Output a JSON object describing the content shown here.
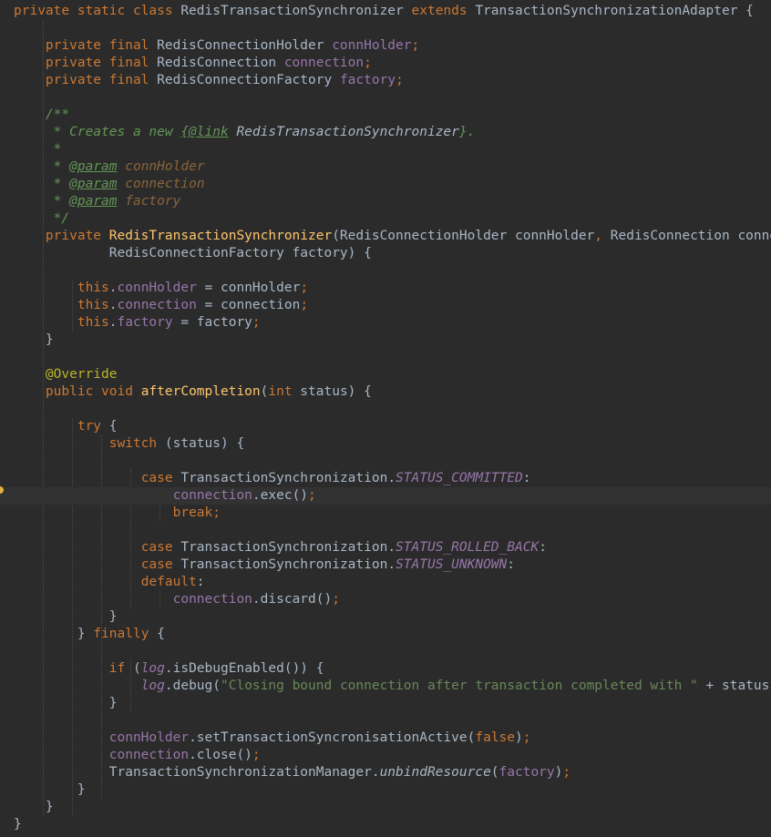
{
  "editor": {
    "language": "Java",
    "theme_colors": {
      "background": "#2b2b2b",
      "current_line": "#323232",
      "keyword": "#cc7832",
      "plain": "#a9b7c6",
      "method_declaration": "#ffc66d",
      "field": "#9876aa",
      "string": "#6a8759",
      "annotation": "#bbb529",
      "doc_comment": "#629755",
      "doc_param": "#8a653b",
      "breakpoint_marker": "#e2b33c"
    },
    "current_line_number": 29,
    "lines": [
      [
        [
          "kw",
          "private static class "
        ],
        [
          "plain",
          "RedisTransactionSynchronizer "
        ],
        [
          "kw",
          "extends "
        ],
        [
          "plain",
          "TransactionSynchronizationAdapter {"
        ]
      ],
      [],
      [
        [
          "plain",
          "    "
        ],
        [
          "kw",
          "private final "
        ],
        [
          "plain",
          "RedisConnectionHolder "
        ],
        [
          "field",
          "connHolder"
        ],
        [
          "kw",
          ";"
        ]
      ],
      [
        [
          "plain",
          "    "
        ],
        [
          "kw",
          "private final "
        ],
        [
          "plain",
          "RedisConnection "
        ],
        [
          "field",
          "connection"
        ],
        [
          "kw",
          ";"
        ]
      ],
      [
        [
          "plain",
          "    "
        ],
        [
          "kw",
          "private final "
        ],
        [
          "plain",
          "RedisConnectionFactory "
        ],
        [
          "field",
          "factory"
        ],
        [
          "kw",
          ";"
        ]
      ],
      [],
      [
        [
          "plain",
          "    "
        ],
        [
          "doc",
          "/**"
        ]
      ],
      [
        [
          "plain",
          "    "
        ],
        [
          "doc",
          " * Creates a new "
        ],
        [
          "doclink",
          "{@link"
        ],
        [
          "doclinkref",
          " RedisTransactionSynchronizer"
        ],
        [
          "doc",
          "}."
        ]
      ],
      [
        [
          "plain",
          "    "
        ],
        [
          "doc",
          " *"
        ]
      ],
      [
        [
          "plain",
          "    "
        ],
        [
          "doc",
          " * "
        ],
        [
          "doctag",
          "@param"
        ],
        [
          "docparam",
          " connHolder"
        ]
      ],
      [
        [
          "plain",
          "    "
        ],
        [
          "doc",
          " * "
        ],
        [
          "doctag",
          "@param"
        ],
        [
          "docparam",
          " connection"
        ]
      ],
      [
        [
          "plain",
          "    "
        ],
        [
          "doc",
          " * "
        ],
        [
          "doctag",
          "@param"
        ],
        [
          "docparam",
          " factory"
        ]
      ],
      [
        [
          "plain",
          "    "
        ],
        [
          "doc",
          " */"
        ]
      ],
      [
        [
          "plain",
          "    "
        ],
        [
          "kw",
          "private "
        ],
        [
          "fn",
          "RedisTransactionSynchronizer"
        ],
        [
          "plain",
          "(RedisConnectionHolder connHolder"
        ],
        [
          "kw",
          ", "
        ],
        [
          "plain",
          "RedisConnection connection"
        ],
        [
          "kw",
          ","
        ]
      ],
      [
        [
          "plain",
          "            RedisConnectionFactory factory) {"
        ]
      ],
      [],
      [
        [
          "plain",
          "        "
        ],
        [
          "kw",
          "this"
        ],
        [
          "plain",
          "."
        ],
        [
          "field",
          "connHolder"
        ],
        [
          "plain",
          " = connHolder"
        ],
        [
          "kw",
          ";"
        ]
      ],
      [
        [
          "plain",
          "        "
        ],
        [
          "kw",
          "this"
        ],
        [
          "plain",
          "."
        ],
        [
          "field",
          "connection"
        ],
        [
          "plain",
          " = connection"
        ],
        [
          "kw",
          ";"
        ]
      ],
      [
        [
          "plain",
          "        "
        ],
        [
          "kw",
          "this"
        ],
        [
          "plain",
          "."
        ],
        [
          "field",
          "factory"
        ],
        [
          "plain",
          " = factory"
        ],
        [
          "kw",
          ";"
        ]
      ],
      [
        [
          "plain",
          "    }"
        ]
      ],
      [],
      [
        [
          "plain",
          "    "
        ],
        [
          "anno",
          "@Override"
        ]
      ],
      [
        [
          "plain",
          "    "
        ],
        [
          "kw",
          "public void "
        ],
        [
          "fn",
          "afterCompletion"
        ],
        [
          "plain",
          "("
        ],
        [
          "kw",
          "int "
        ],
        [
          "plain",
          "status) {"
        ]
      ],
      [],
      [
        [
          "plain",
          "        "
        ],
        [
          "kw",
          "try "
        ],
        [
          "plain",
          "{"
        ]
      ],
      [
        [
          "plain",
          "            "
        ],
        [
          "kw",
          "switch "
        ],
        [
          "plain",
          "(status) {"
        ]
      ],
      [],
      [
        [
          "plain",
          "                "
        ],
        [
          "kw",
          "case "
        ],
        [
          "plain",
          "TransactionSynchronization."
        ],
        [
          "sfield",
          "STATUS_COMMITTED"
        ],
        [
          "plain",
          ":"
        ]
      ],
      [
        [
          "plain",
          "                    "
        ],
        [
          "field",
          "connection"
        ],
        [
          "plain",
          ".exec()"
        ],
        [
          "kw",
          ";"
        ]
      ],
      [
        [
          "plain",
          "                    "
        ],
        [
          "kw",
          "break;"
        ]
      ],
      [],
      [
        [
          "plain",
          "                "
        ],
        [
          "kw",
          "case "
        ],
        [
          "plain",
          "TransactionSynchronization."
        ],
        [
          "sfield",
          "STATUS_ROLLED_BACK"
        ],
        [
          "plain",
          ":"
        ]
      ],
      [
        [
          "plain",
          "                "
        ],
        [
          "kw",
          "case "
        ],
        [
          "plain",
          "TransactionSynchronization."
        ],
        [
          "sfield",
          "STATUS_UNKNOWN"
        ],
        [
          "plain",
          ":"
        ]
      ],
      [
        [
          "plain",
          "                "
        ],
        [
          "kw",
          "default"
        ],
        [
          "plain",
          ":"
        ]
      ],
      [
        [
          "plain",
          "                    "
        ],
        [
          "field",
          "connection"
        ],
        [
          "plain",
          ".discard()"
        ],
        [
          "kw",
          ";"
        ]
      ],
      [
        [
          "plain",
          "            }"
        ]
      ],
      [
        [
          "plain",
          "        } "
        ],
        [
          "kw",
          "finally "
        ],
        [
          "plain",
          "{"
        ]
      ],
      [],
      [
        [
          "plain",
          "            "
        ],
        [
          "kw",
          "if "
        ],
        [
          "plain",
          "("
        ],
        [
          "sfield",
          "log"
        ],
        [
          "plain",
          ".isDebugEnabled()) {"
        ]
      ],
      [
        [
          "plain",
          "                "
        ],
        [
          "sfield",
          "log"
        ],
        [
          "plain",
          ".debug("
        ],
        [
          "str",
          "\"Closing bound connection after transaction completed with \""
        ],
        [
          "plain",
          " + status)"
        ],
        [
          "kw",
          ";"
        ]
      ],
      [
        [
          "plain",
          "            }"
        ]
      ],
      [],
      [
        [
          "plain",
          "            "
        ],
        [
          "field",
          "connHolder"
        ],
        [
          "plain",
          ".setTransactionSyncronisationActive("
        ],
        [
          "kw",
          "false"
        ],
        [
          "plain",
          ")"
        ],
        [
          "kw",
          ";"
        ]
      ],
      [
        [
          "plain",
          "            "
        ],
        [
          "field",
          "connection"
        ],
        [
          "plain",
          ".close()"
        ],
        [
          "kw",
          ";"
        ]
      ],
      [
        [
          "plain",
          "            TransactionSynchronizationManager."
        ],
        [
          "smethod",
          "unbindResource"
        ],
        [
          "plain",
          "("
        ],
        [
          "field",
          "factory"
        ],
        [
          "plain",
          ")"
        ],
        [
          "kw",
          ";"
        ]
      ],
      [
        [
          "plain",
          "        }"
        ]
      ],
      [
        [
          "plain",
          "    }"
        ]
      ],
      [
        [
          "plain",
          "}"
        ]
      ]
    ]
  }
}
